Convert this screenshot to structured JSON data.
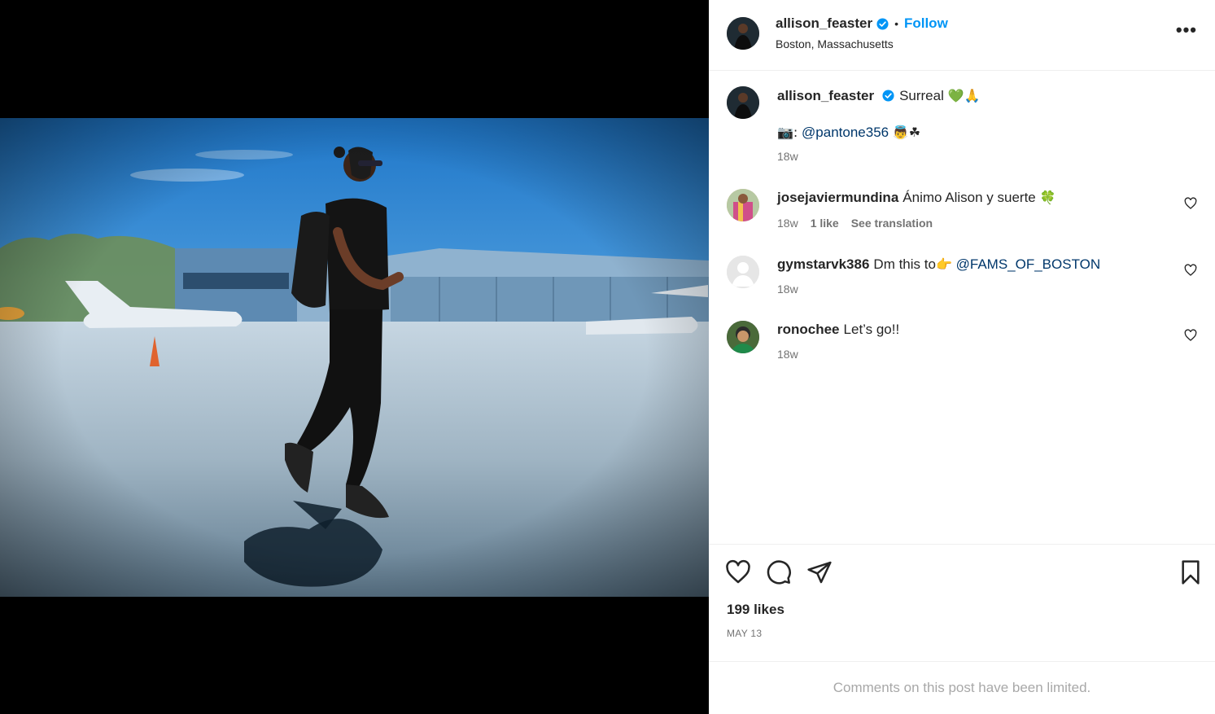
{
  "post": {
    "username": "allison_feaster",
    "follow_label": "Follow",
    "separator": "•",
    "location": "Boston, Massachusetts",
    "more_label": "•••"
  },
  "caption": {
    "username": "allison_feaster",
    "text": "Surreal",
    "text_emoji": "💚🙏",
    "credit_prefix": "📷:",
    "credit_mention": "@pantone356",
    "credit_emoji": "👼☘",
    "time": "18w"
  },
  "comments": [
    {
      "username": "josejaviermundina",
      "text": "Ánimo Alison y suerte",
      "emoji": "🍀",
      "time": "18w",
      "likes": "1 like",
      "translate": "See translation"
    },
    {
      "username": "gymstarvk386",
      "text": "Dm this to",
      "emoji": "👉",
      "mention": "@FAMS_OF_BOSTON",
      "time": "18w"
    },
    {
      "username": "ronochee",
      "text": "Let’s go!!",
      "time": "18w"
    }
  ],
  "footer": {
    "likes": "199 likes",
    "date": "MAY 13",
    "limited": "Comments on this post have been limited."
  },
  "colors": {
    "accent": "#0095f6",
    "mention": "#00376b",
    "muted": "#737373"
  }
}
